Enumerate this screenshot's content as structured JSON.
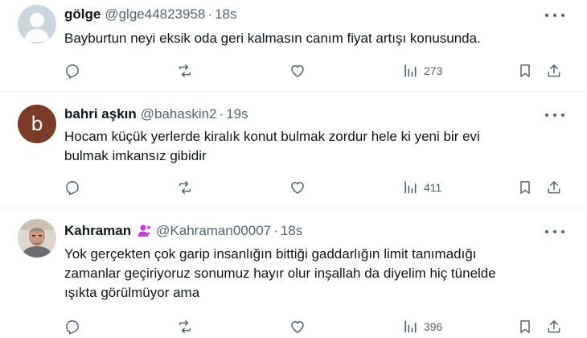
{
  "tweets": [
    {
      "name": "gölge",
      "handle": "@glge44823958",
      "dot": "·",
      "time": "18s",
      "avatar_letter": "",
      "text": [
        "Bayburtun neyi eksik oda geri kalmasın canım fiyat artışı konusunda."
      ],
      "views": "273"
    },
    {
      "name": "bahri aşkın",
      "handle": "@bahaskin2",
      "dot": "·",
      "time": "19s",
      "avatar_letter": "b",
      "text": [
        "Hocam küçük yerlerde kiralık konut bulmak zordur hele ki yeni bir evi",
        "bulmak imkansız gibidir"
      ],
      "views": "411"
    },
    {
      "name": "Kahraman",
      "handle": "@Kahraman00007",
      "dot": "·",
      "time": "18s",
      "avatar_letter": "",
      "text": [
        "Yok gerçekten çok garip insanlığın bittiği gaddarlığın limit tanımadığı",
        "zamanlar geçiriyoruz sonumuz hayır olur inşallah da diyelim hiç tünelde",
        "ışıkta görülmüyor ama"
      ],
      "views": "396"
    }
  ],
  "icons": {
    "reply": "reply-icon",
    "repost": "repost-icon",
    "like": "heart-icon",
    "views": "views-icon",
    "bookmark": "bookmark-icon",
    "share": "share-icon",
    "more": "more-icon",
    "badge": "person-badge-icon"
  },
  "colors": {
    "text": "#0f1419",
    "secondary": "#536471",
    "divider": "#eff3f4",
    "badge": "#c13ed6"
  }
}
